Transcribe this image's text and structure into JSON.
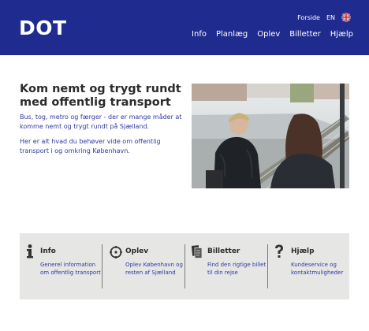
{
  "header": {
    "logo": "DOT",
    "util": {
      "home_label": "Forside",
      "lang_label": "EN"
    },
    "nav": [
      "Info",
      "Planlæg",
      "Oplev",
      "Billetter",
      "Hjælp"
    ]
  },
  "hero": {
    "title": "Kom nemt og trygt rundt med offentlig transport",
    "text1": "Bus, tog, metro og færger - der er mange måder at komme nemt og trygt rundt på Sjælland.",
    "text2": "Her er alt hvad du behøver vide om offentlig transport i og omkring København."
  },
  "features": [
    {
      "icon": "info-icon",
      "title": "Info",
      "text": "Generel information om offentlig transport"
    },
    {
      "icon": "compass-icon",
      "title": "Oplev",
      "text": "Oplev København og resten af Sjælland"
    },
    {
      "icon": "ticket-icon",
      "title": "Billetter",
      "text": "Find den rigtige billet til din rejse"
    },
    {
      "icon": "help-icon",
      "title": "Hjælp",
      "text": "Kundeservice og kontaktmuligheder"
    }
  ],
  "colors": {
    "header_bg": "#1f2b8f",
    "link": "#2f39a3",
    "panel_bg": "#e6e6e4"
  }
}
